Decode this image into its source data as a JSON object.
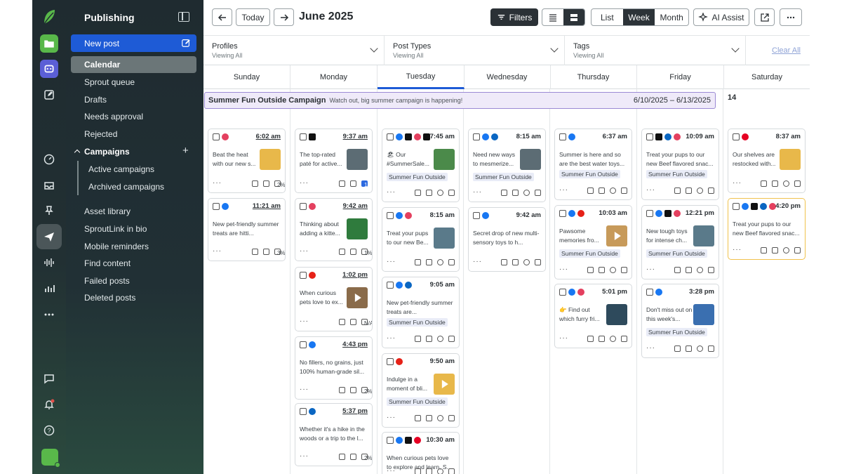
{
  "nav": {
    "title": "Publishing",
    "new_post": "New post",
    "items": [
      "Calendar",
      "Sprout queue",
      "Drafts",
      "Needs approval",
      "Rejected"
    ],
    "campaigns": "Campaigns",
    "campaign_items": [
      "Active campaigns",
      "Archived campaigns"
    ],
    "more_items": [
      "Asset library",
      "SproutLink in bio",
      "Mobile reminders",
      "Find content",
      "Failed posts",
      "Deleted posts"
    ]
  },
  "toolbar": {
    "today": "Today",
    "month_title": "June 2025",
    "filters": "Filters",
    "views": [
      "List",
      "Week",
      "Month"
    ],
    "active_view": "Week",
    "ai_assist": "AI Assist"
  },
  "filters": [
    {
      "label": "Profiles",
      "value": "Viewing All"
    },
    {
      "label": "Post Types",
      "value": "Viewing All"
    },
    {
      "label": "Tags",
      "value": "Viewing All"
    }
  ],
  "clear_all": "Clear All",
  "days": [
    "Sunday",
    "Monday",
    "Tuesday",
    "Wednesday",
    "Thursday",
    "Friday",
    "Saturday"
  ],
  "current_day": "Tuesday",
  "campaign_banner": {
    "title": "Summer Fun Outside Campaign",
    "subtitle": "Watch out, big summer campaign is happening!",
    "dates": "6/10/2025 – 6/13/2025"
  },
  "saturday_date": "14",
  "campaign_tag": "Summer Fun Outside",
  "colors": {
    "accent": "#1e5bd6",
    "sidebar": "#1f2b30",
    "campaign_border": "#9b8ad4",
    "highlight": "#f0c24d"
  },
  "posts": [
    {
      "day": 0,
      "time": "6:02 am",
      "text": "Beat the heat with our new s...",
      "stat": "2%",
      "networks": [
        "instagram"
      ]
    },
    {
      "day": 0,
      "time": "11:21 am",
      "text": "New pet-friendly summer treats are hitti...",
      "stat": "3%",
      "networks": [
        "facebook"
      ]
    },
    {
      "day": 1,
      "time": "9:37 am",
      "text": "The top-rated paté for active...",
      "stat": "18%",
      "networks": [
        "x"
      ]
    },
    {
      "day": 1,
      "time": "9:42 am",
      "text": "Thinking about adding a kitte...",
      "stat": "1%",
      "networks": [
        "instagram"
      ]
    },
    {
      "day": 1,
      "time": "1:02 pm",
      "text": "When curious pets love to ex...",
      "stat": "N/A",
      "networks": [
        "youtube"
      ]
    },
    {
      "day": 1,
      "time": "4:43 pm",
      "text": "No fillers, no grains, just 100% human-grade sil...",
      "stat": "2%",
      "networks": [
        "facebook"
      ]
    },
    {
      "day": 1,
      "time": "5:37 pm",
      "text": "Whether it's a hike in the woods or a trip to the l...",
      "stat": "2%",
      "networks": [
        "linkedin"
      ]
    },
    {
      "day": 2,
      "time": "7:45 am",
      "text": "🏖 Our #SummerSale...",
      "networks": [
        "facebook",
        "x",
        "instagram",
        "threads"
      ]
    },
    {
      "day": 2,
      "time": "8:15 am",
      "text": "Treat your pups to our new Be...",
      "networks": [
        "facebook",
        "instagram"
      ]
    },
    {
      "day": 2,
      "time": "9:05 am",
      "text": "New pet-friendly summer treats are...",
      "networks": [
        "facebook",
        "linkedin"
      ]
    },
    {
      "day": 2,
      "time": "9:50 am",
      "text": "Indulge in a moment of bli...",
      "networks": [
        "youtube"
      ]
    },
    {
      "day": 2,
      "time": "10:30 am",
      "text": "When curious pets love to explore and learn, S...",
      "networks": [
        "facebook",
        "x",
        "pinterest"
      ]
    },
    {
      "day": 3,
      "time": "8:15 am",
      "text": "Need new ways to mesmerize...",
      "networks": [
        "facebook",
        "linkedin"
      ]
    },
    {
      "day": 3,
      "time": "9:42 am",
      "text": "Secret drop of new multi-sensory toys to h...",
      "networks": [
        "facebook"
      ]
    },
    {
      "day": 4,
      "time": "6:37 am",
      "text": "Summer is here and so are the best water toys...",
      "networks": [
        "facebook"
      ]
    },
    {
      "day": 4,
      "time": "10:03 am",
      "text": "Pawsome memories fro...",
      "networks": [
        "facebook",
        "youtube"
      ]
    },
    {
      "day": 4,
      "time": "5:01 pm",
      "text": "👉 Find out which furry fri...",
      "networks": [
        "facebook",
        "instagram"
      ]
    },
    {
      "day": 5,
      "time": "10:09 am",
      "text": "Treat your pups to our new Beef flavored snac...",
      "networks": [
        "x",
        "linkedin",
        "instagram"
      ]
    },
    {
      "day": 5,
      "time": "12:21 pm",
      "text": "New tough toys for intense ch...",
      "networks": [
        "facebook",
        "x",
        "instagram"
      ]
    },
    {
      "day": 5,
      "time": "3:28 pm",
      "text": "Don't miss out on this week's...",
      "networks": [
        "facebook"
      ]
    },
    {
      "day": 6,
      "time": "8:37 am",
      "text": "Our shelves are restocked with...",
      "networks": [
        "pinterest"
      ]
    },
    {
      "day": 6,
      "time": "4:20 pm",
      "text": "Treat your pups to our new Beef flavored snac...",
      "networks": [
        "facebook",
        "x",
        "linkedin",
        "instagram"
      ]
    }
  ]
}
